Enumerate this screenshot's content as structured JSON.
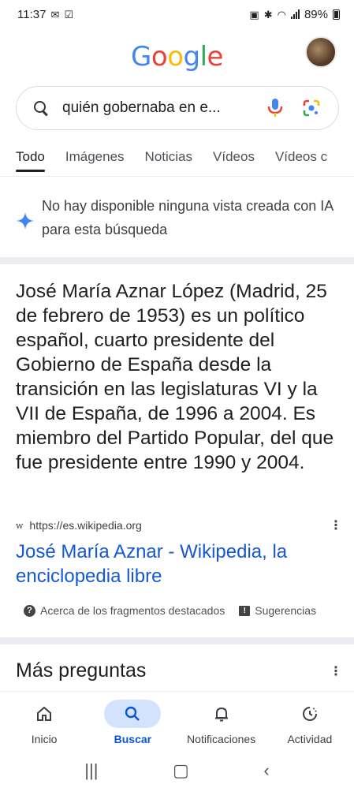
{
  "status_bar": {
    "time": "11:37",
    "battery_percent": "89%"
  },
  "header": {
    "logo_letters": [
      {
        "char": "G",
        "color": "#4285F4"
      },
      {
        "char": "o",
        "color": "#EA4335"
      },
      {
        "char": "o",
        "color": "#FBBC05"
      },
      {
        "char": "g",
        "color": "#4285F4"
      },
      {
        "char": "l",
        "color": "#34A853"
      },
      {
        "char": "e",
        "color": "#EA4335"
      }
    ]
  },
  "search": {
    "query": "quién gobernaba en e..."
  },
  "tabs": [
    "Todo",
    "Imágenes",
    "Noticias",
    "Vídeos",
    "Vídeos c"
  ],
  "ai_notice": {
    "text": "No hay disponible ninguna vista creada con IA para esta búsqueda"
  },
  "featured_snippet": {
    "text": "José María Aznar López (Madrid, 25 de febrero de 1953) es un político español, cuarto presidente del Gobierno de España desde la transición en las legislaturas VI y la VII de España, de 1996 a 2004. Es miembro del Partido Popular, del que fue presidente entre 1990 y 2004.",
    "source_icon": "w",
    "source_url": "https://es.wikipedia.org",
    "title": "José María Aznar - Wikipedia, la enciclopedia libre",
    "about_label": "Acerca de los fragmentos destacados",
    "feedback_label": "Sugerencias"
  },
  "more_questions": {
    "heading": "Más preguntas"
  },
  "bottom_nav": {
    "items": [
      {
        "label": "Inicio",
        "icon": "home-icon"
      },
      {
        "label": "Buscar",
        "icon": "search-icon"
      },
      {
        "label": "Notificaciones",
        "icon": "bell-icon"
      },
      {
        "label": "Actividad",
        "icon": "activity-icon"
      }
    ]
  },
  "colors": {
    "link": "#1558D6",
    "nav_active_bg": "#D3E3FD",
    "nav_active_text": "#0B57D0"
  }
}
